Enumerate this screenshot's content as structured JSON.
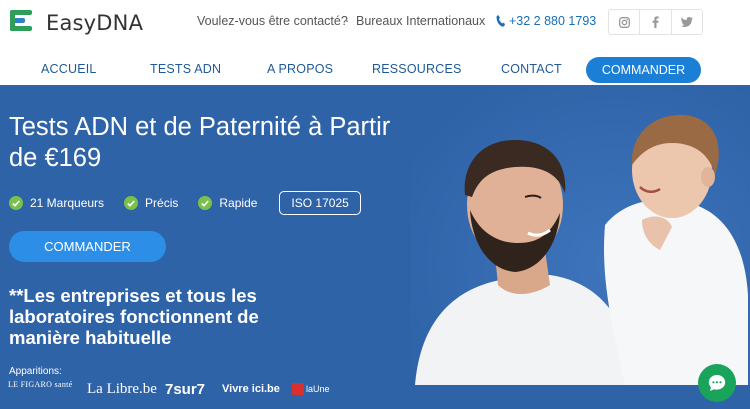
{
  "header": {
    "logo_text": "EasyDNA",
    "contact_link": "Voulez-vous être contacté?",
    "separator": "·",
    "offices_link": "Bureaux Internationaux",
    "phone": "+32 2 880 1793",
    "social": [
      "instagram-icon",
      "facebook-icon",
      "twitter-icon"
    ]
  },
  "nav": {
    "items": [
      "ACCUEIL",
      "TESTS ADN",
      "A PROPOS",
      "RESSOURCES",
      "CONTACT"
    ],
    "cta": "COMMANDER"
  },
  "hero": {
    "title": "Tests ADN et de Paternité à Partir de €169",
    "features": [
      "21 Marqueurs",
      "Précis",
      "Rapide"
    ],
    "iso_badge": "ISO 17025",
    "cta": "COMMANDER",
    "notice": "**Les entreprises et tous les laboratoires fonctionnent de manière habituelle",
    "apparitions_label": "Apparitions:",
    "press": [
      "LE FIGARO santé",
      "La Libre.be",
      "7sur7",
      "Vivre ici.be",
      "laUne"
    ]
  },
  "colors": {
    "hero_bg": "#2f63a8",
    "accent": "#1c7fd6",
    "check": "#7bc04b",
    "chat": "#19a35b"
  }
}
